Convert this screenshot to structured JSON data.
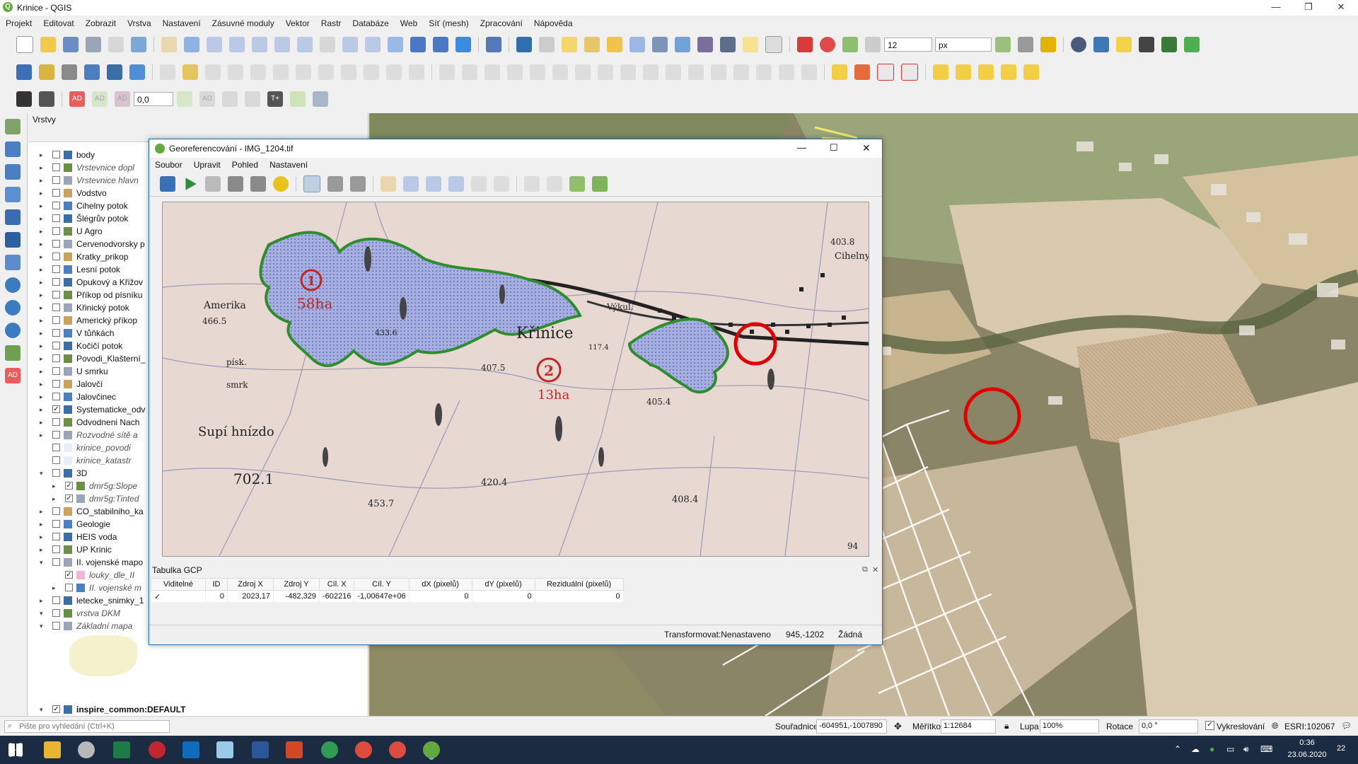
{
  "window": {
    "title": "Krinice - QGIS",
    "minimize": "—",
    "maximize": "❐",
    "close": "✕"
  },
  "menu": [
    "Projekt",
    "Editovat",
    "Zobrazit",
    "Vrstva",
    "Nastavení",
    "Zásuvné moduly",
    "Vektor",
    "Rastr",
    "Databáze",
    "Web",
    "Síť (mesh)",
    "Zpracování",
    "Nápověda"
  ],
  "toolbar": {
    "font_size": "12",
    "unit": "px",
    "rotation_spin": "0,0"
  },
  "left_toolbar_badge": "AD",
  "label_toolbar": [
    "AD",
    "AD",
    "AD",
    "AD",
    "T+"
  ],
  "layers_panel": {
    "title": "Vrstvy",
    "items": [
      {
        "name": "body",
        "checked": false,
        "italic": false,
        "expand": "▸"
      },
      {
        "name": "Vrstevnice dopl",
        "checked": false,
        "italic": true,
        "expand": "▸"
      },
      {
        "name": "Vrstevnice hlavn",
        "checked": false,
        "italic": true,
        "expand": "▸"
      },
      {
        "name": "Vodstvo",
        "checked": false,
        "italic": false,
        "expand": "▸"
      },
      {
        "name": "Cihelny potok",
        "checked": false,
        "italic": false,
        "expand": "▸"
      },
      {
        "name": "Šlégrův potok",
        "checked": false,
        "italic": false,
        "expand": "▸"
      },
      {
        "name": "U Agro",
        "checked": false,
        "italic": false,
        "expand": "▸"
      },
      {
        "name": "Cervenodvorsky p",
        "checked": false,
        "italic": false,
        "expand": "▸"
      },
      {
        "name": "Kratky_prikop",
        "checked": false,
        "italic": false,
        "expand": "▸"
      },
      {
        "name": "Lesní potok",
        "checked": false,
        "italic": false,
        "expand": "▸"
      },
      {
        "name": "Opukový a Křižov",
        "checked": false,
        "italic": false,
        "expand": "▸"
      },
      {
        "name": "Příkop od písníku",
        "checked": false,
        "italic": false,
        "expand": "▸"
      },
      {
        "name": "Křinický potok",
        "checked": false,
        "italic": false,
        "expand": "▸"
      },
      {
        "name": "Americký příkop",
        "checked": false,
        "italic": false,
        "expand": "▸"
      },
      {
        "name": "V tůňkách",
        "checked": false,
        "italic": false,
        "expand": "▸"
      },
      {
        "name": "Kočičí potok",
        "checked": false,
        "italic": false,
        "expand": "▸"
      },
      {
        "name": "Povodi_Klašterní_",
        "checked": false,
        "italic": false,
        "expand": "▸"
      },
      {
        "name": "U smrku",
        "checked": false,
        "italic": false,
        "expand": "▸"
      },
      {
        "name": "Jalovčí",
        "checked": false,
        "italic": false,
        "expand": "▸"
      },
      {
        "name": "Jalovčinec",
        "checked": false,
        "italic": false,
        "expand": "▸"
      },
      {
        "name": "Systematicke_odv",
        "checked": true,
        "italic": false,
        "expand": "▸"
      },
      {
        "name": "Odvodneni Nach",
        "checked": false,
        "italic": false,
        "expand": "▸"
      },
      {
        "name": "Rozvodné sítě a ",
        "checked": false,
        "italic": true,
        "expand": "▸"
      },
      {
        "name": "krinice_povodi",
        "checked": false,
        "italic": true,
        "expand": ""
      },
      {
        "name": "krinice_katastr",
        "checked": false,
        "italic": true,
        "expand": ""
      },
      {
        "name": "3D",
        "checked": false,
        "italic": false,
        "expand": "▾"
      },
      {
        "name": "dmr5g:Slope",
        "checked": true,
        "italic": true,
        "expand": "▸",
        "indent": true
      },
      {
        "name": "dmr5g:Tinted",
        "checked": true,
        "italic": true,
        "expand": "▸",
        "indent": true
      },
      {
        "name": "CO_stabilniho_ka",
        "checked": false,
        "italic": false,
        "expand": "▸"
      },
      {
        "name": "Geologie",
        "checked": false,
        "italic": false,
        "expand": "▸"
      },
      {
        "name": "HEIS voda",
        "checked": false,
        "italic": false,
        "expand": "▸"
      },
      {
        "name": "UP Krinic",
        "checked": false,
        "italic": false,
        "expand": "▸"
      },
      {
        "name": "II. vojenské mapo",
        "checked": false,
        "italic": false,
        "expand": "▾"
      },
      {
        "name": "louky_dle_II",
        "checked": true,
        "italic": true,
        "expand": "",
        "indent": true
      },
      {
        "name": "II. vojenské m",
        "checked": false,
        "italic": true,
        "expand": "▸",
        "indent": true
      },
      {
        "name": "letecke_snimky_1",
        "checked": false,
        "italic": false,
        "expand": "▸"
      },
      {
        "name": "vrstva DKM",
        "checked": false,
        "italic": true,
        "expand": "▾"
      },
      {
        "name": "Základní mapa ",
        "checked": false,
        "italic": true,
        "expand": "▾"
      }
    ],
    "bottom_item": "inspire_common:DEFAULT"
  },
  "dialog": {
    "title": "Georeferencování - IMG_1204.tif",
    "menu": [
      "Soubor",
      "Upravit",
      "Pohled",
      "Nastavení"
    ],
    "map_labels": {
      "amerika": "Amerika",
      "krinice": "Křinice",
      "supi": "Supí hnízdo",
      "cihelny": "Cihelny",
      "vykul": "Výkul.",
      "pisk": "písk.",
      "smrk": "smrk",
      "area1_num": "1",
      "area1_size": "58ha",
      "area2_num": "2",
      "area2_size": "13ha",
      "h1": "466.5",
      "h2": "702.1",
      "h3": "420.4",
      "h4": "453.7",
      "h5": "408.4",
      "h6": "405.4",
      "h7": "407.5",
      "h8": "433.6",
      "h9": "403.8",
      "h10": "117.4",
      "page": "94"
    },
    "gcp_title": "Tabulka GCP",
    "gcp_headers": [
      "Viditelné",
      "ID",
      "Zdroj X",
      "Zdroj Y",
      "Cíl. X",
      "Cíl. Y",
      "dX (pixelů)",
      "dY (pixelů)",
      "Reziduální (pixelů)"
    ],
    "gcp_rows": [
      [
        "✓",
        "0",
        "2023,17",
        "-482,329",
        "-602216",
        "-1,00647e+06",
        "0",
        "0",
        "0"
      ]
    ],
    "status_transform": "Transformovat:Nenastaveno",
    "status_coords": "945,-1202",
    "status_none": "Žádná"
  },
  "statusbar": {
    "search_placeholder": "Pište pro vyhledání (Ctrl+K)",
    "coord_label": "Souřadnice",
    "coord_value": "-604951,-1007890",
    "scale_label": "Měřítko",
    "scale_value": "1:12684",
    "magnifier_label": "Lupa",
    "magnifier_value": "100%",
    "rotation_label": "Rotace",
    "rotation_value": "0,0 °",
    "render_label": "Vykreslování",
    "crs": "ESRI:102067"
  },
  "taskbar": {
    "time": "0:36",
    "date": "23.06.2020",
    "notifications": "22"
  }
}
